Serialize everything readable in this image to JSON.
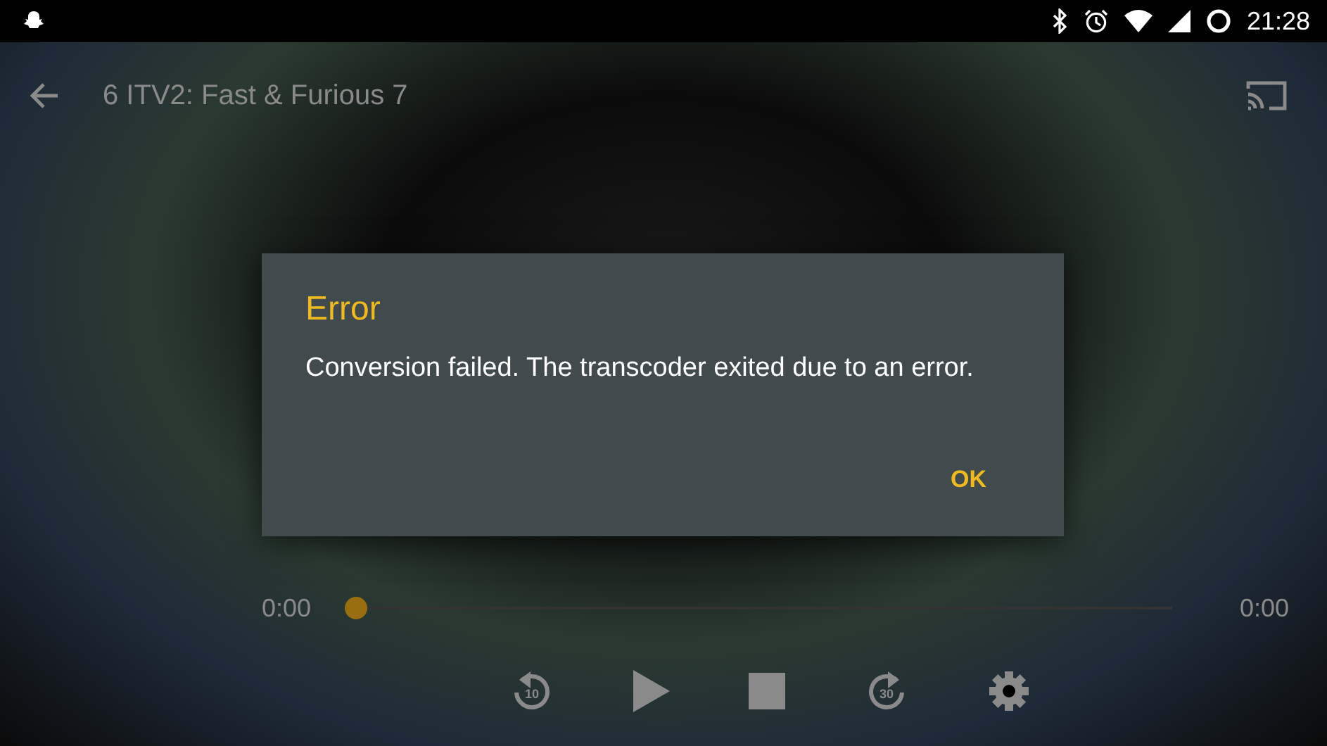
{
  "status_bar": {
    "time": "21:28"
  },
  "toolbar": {
    "title": "6 ITV2: Fast & Furious 7"
  },
  "dialog": {
    "title": "Error",
    "message": "Conversion failed. The transcoder exited due to an error.",
    "buttons": [
      "OK"
    ]
  },
  "player": {
    "elapsed": "0:00",
    "duration": "0:00",
    "level": 0,
    "controls": [
      {
        "kind": "rewind",
        "label": "10"
      },
      {
        "kind": "play"
      },
      {
        "kind": "stop"
      },
      {
        "kind": "forward",
        "label": "30"
      },
      {
        "kind": "settings"
      }
    ]
  }
}
